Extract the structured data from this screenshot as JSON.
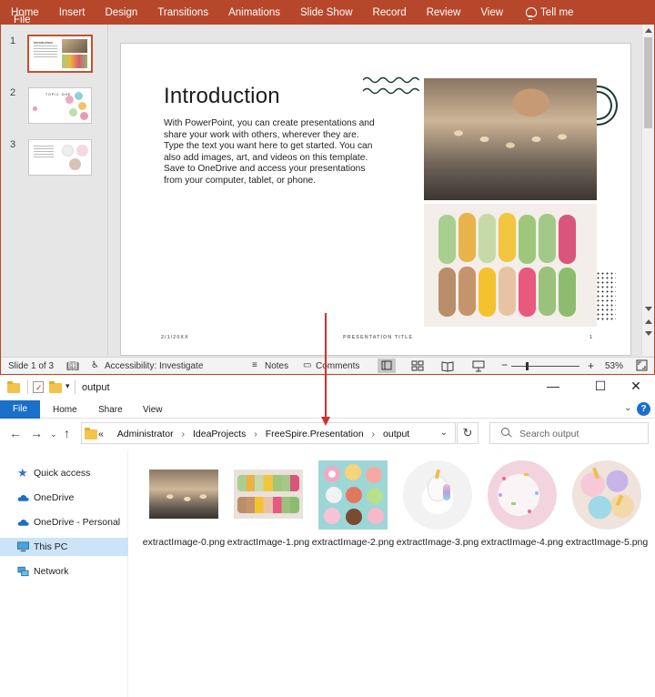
{
  "ppt": {
    "ribbon_tabs": [
      "File",
      "Home",
      "Insert",
      "Design",
      "Transitions",
      "Animations",
      "Slide Show",
      "Record",
      "Review",
      "View"
    ],
    "tell_me": "Tell me",
    "thumbs": [
      {
        "num": "1",
        "title": "Introduction"
      },
      {
        "num": "2",
        "title": "TOPIC ONE"
      },
      {
        "num": "3",
        "title": ""
      }
    ],
    "slide": {
      "title": "Introduction",
      "body": "With PowerPoint, you can create presentations and share your work with others, wherever they are. Type the text you want here to get started. You can also add images, art, and videos on this template. Save to OneDrive and access your presentations from your computer, tablet, or phone.",
      "footer_date": "2/1/20XX",
      "footer_title": "PRESENTATION TITLE",
      "footer_page": "1"
    },
    "status": {
      "slide": "Slide 1 of 3",
      "accessibility": "Accessibility: Investigate",
      "notes": "Notes",
      "comments": "Comments",
      "zoom_minus": "−",
      "zoom_plus": "+",
      "zoom": "53%"
    }
  },
  "explorer": {
    "title": "output",
    "tabs": {
      "file": "File",
      "home": "Home",
      "share": "Share",
      "view": "View"
    },
    "path": [
      "Administrator",
      "IdeaProjects",
      "FreeSpire.Presentation",
      "output"
    ],
    "path_prefix": "«",
    "search_placeholder": "Search output",
    "nav": [
      {
        "label": "Quick access"
      },
      {
        "label": "OneDrive"
      },
      {
        "label": "OneDrive - Personal"
      },
      {
        "label": "This PC"
      },
      {
        "label": "Network"
      }
    ],
    "files": [
      {
        "name": "extractImage-0.png"
      },
      {
        "name": "extractImage-1.png"
      },
      {
        "name": "extractImage-2.png"
      },
      {
        "name": "extractImage-3.png"
      },
      {
        "name": "extractImage-4.png"
      },
      {
        "name": "extractImage-5.png"
      }
    ]
  },
  "colors": {
    "ppt_accent": "#b7472a",
    "explorer_accent": "#1a6fc9",
    "arrow": "#d32f2f"
  }
}
